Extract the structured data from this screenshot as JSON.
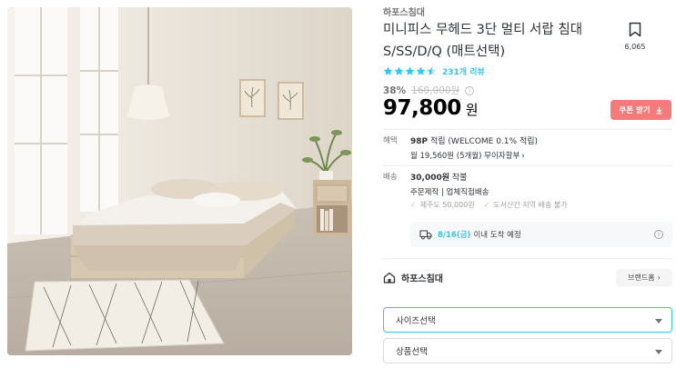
{
  "product": {
    "brand": "하포스침대",
    "title": "미니피스 무헤드 3단 멀티 서랍 침대 S/SS/D/Q (매트선택)",
    "scrap_count": "6,065",
    "rating_stars": 4.5,
    "review_count": "231개 리뷰",
    "discount_rate": "38%",
    "original_price": "160,000원",
    "price": "97,800",
    "price_unit": "원",
    "coupon_label": "쿠폰 받기"
  },
  "benefit": {
    "label": "혜택",
    "points": "98P",
    "points_detail": "적립 (WELCOME 0.1% 적립)",
    "installment": "월 19,560원 (5개월) 무이자할부",
    "installment_chevron": "›"
  },
  "shipping": {
    "label": "배송",
    "fee": "30,000원",
    "fee_suffix": "착불",
    "method": "주문제작 | 업체직접배송",
    "notes": [
      "제주도 50,000원",
      "도서산간 지역 배송 불가"
    ],
    "arrival_date": "8/16(금)",
    "arrival_suffix": "이내 도착 예정"
  },
  "shop": {
    "name": "하포스침대",
    "brand_home_label": "브랜드홈",
    "brand_home_chevron": "›"
  },
  "options": {
    "size_placeholder": "사이즈선택",
    "product_placeholder": "상품선택"
  },
  "colors": {
    "accent": "#35c5f0",
    "coupon": "#f77a7a",
    "star": "#35c5f0"
  },
  "icons": [
    "bookmark-icon",
    "star-icon",
    "info-icon",
    "download-icon",
    "truck-icon",
    "house-icon",
    "check-icon",
    "caret-down-icon"
  ]
}
